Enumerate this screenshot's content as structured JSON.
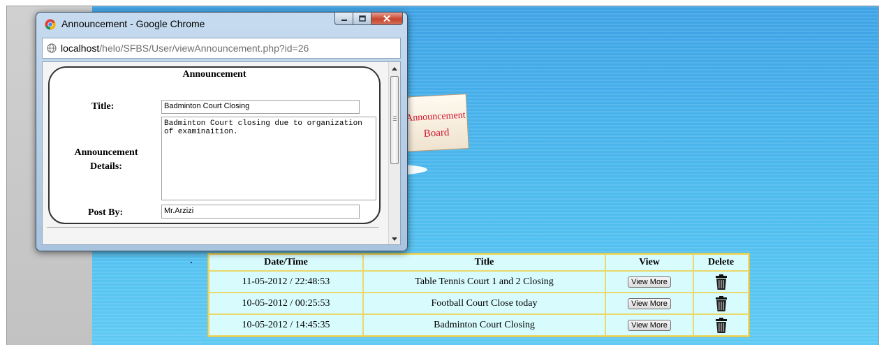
{
  "board": {
    "sign_line1": "Announcement",
    "sign_line2": "Board"
  },
  "table": {
    "headers": {
      "date": "Date/Time",
      "title": "Title",
      "view": "View",
      "delete": "Delete"
    },
    "rows": [
      {
        "date": "11-05-2012 / 22:48:53",
        "title": "Table Tennis Court 1 and 2 Closing",
        "view": "View More"
      },
      {
        "date": "10-05-2012 / 00:25:53",
        "title": "Football Court Close today",
        "view": "View More"
      },
      {
        "date": "10-05-2012 / 14:45:35",
        "title": "Badminton Court Closing",
        "view": "View More"
      }
    ]
  },
  "popup": {
    "window_title": "Announcement - Google Chrome",
    "url_host": "localhost",
    "url_path": "/helo/SFBS/User/viewAnnouncement.php?id=26",
    "heading": "Announcement",
    "title_label": "Title:",
    "title_value": "Badminton Court Closing",
    "details_label": "Announcement Details:",
    "details_value": "Badminton Court closing due to organization of examinaition.",
    "post_label": "Post By:",
    "post_value": "Mr.Arzizi"
  },
  "icons": {
    "back": "left-arrow-icon",
    "delete": "trash-icon",
    "browser": "chrome-icon",
    "page": "globe-icon"
  }
}
